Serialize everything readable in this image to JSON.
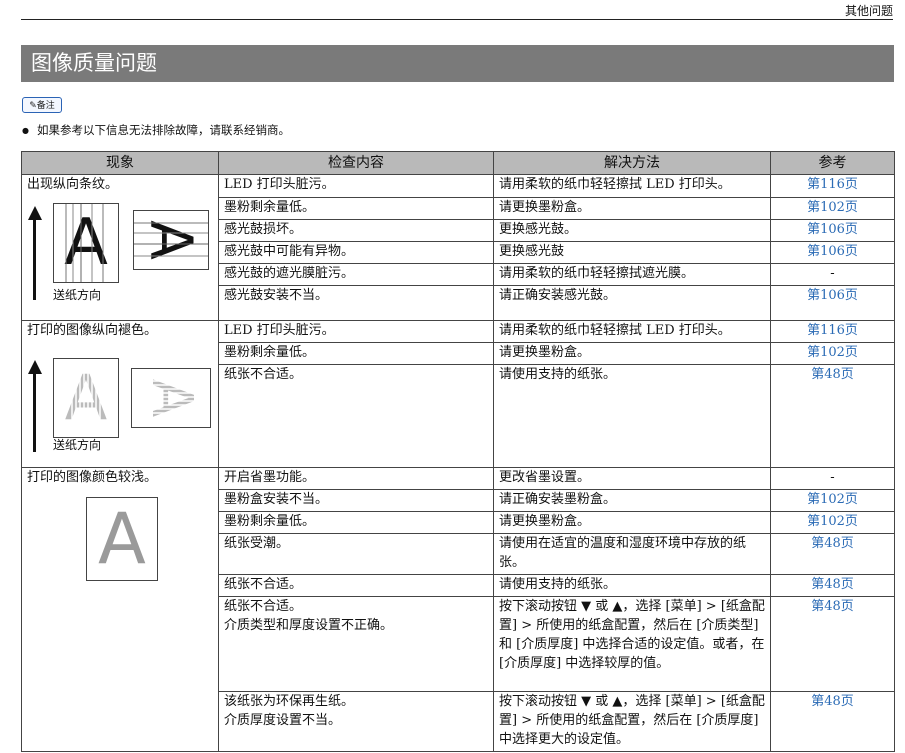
{
  "header": {
    "chapter": "其他问题"
  },
  "section": {
    "title": "图像质量问题"
  },
  "note": {
    "tag": "备注",
    "text": "如果参考以下信息无法排除故障，请联系经销商。"
  },
  "table": {
    "headers": [
      "现象",
      "检查内容",
      "解决方法",
      "参考"
    ],
    "groups": [
      {
        "symptom": "出现纵向条纹。",
        "direction_label": "送纸方向",
        "rows": [
          {
            "check": "LED 打印头脏污。",
            "solution": "请用柔软的纸巾轻轻擦拭 LED 打印头。",
            "ref": "第116页"
          },
          {
            "check": "墨粉剩余量低。",
            "solution": "请更换墨粉盒。",
            "ref": "第102页"
          },
          {
            "check": "感光鼓损坏。",
            "solution": "更换感光鼓。",
            "ref": "第106页"
          },
          {
            "check": "感光鼓中可能有异物。",
            "solution": "更换感光鼓",
            "ref": "第106页"
          },
          {
            "check": "感光鼓的遮光膜脏污。",
            "solution": "请用柔软的纸巾轻轻擦拭遮光膜。",
            "ref": "-"
          },
          {
            "check": "感光鼓安装不当。",
            "solution": "请正确安装感光鼓。",
            "ref": "第106页"
          }
        ]
      },
      {
        "symptom": "打印的图像纵向褪色。",
        "direction_label": "送纸方向",
        "rows": [
          {
            "check": "LED 打印头脏污。",
            "solution": "请用柔软的纸巾轻轻擦拭 LED 打印头。",
            "ref": "第116页"
          },
          {
            "check": "墨粉剩余量低。",
            "solution": "请更换墨粉盒。",
            "ref": "第102页"
          },
          {
            "check": "纸张不合适。",
            "solution": "请使用支持的纸张。",
            "ref": "第48页"
          }
        ]
      },
      {
        "symptom": "打印的图像颜色较浅。",
        "rows": [
          {
            "check": "开启省墨功能。",
            "solution": "更改省墨设置。",
            "ref": "-"
          },
          {
            "check": "墨粉盒安装不当。",
            "solution": "请正确安装墨粉盒。",
            "ref": "第102页"
          },
          {
            "check": "墨粉剩余量低。",
            "solution": "请更换墨粉盒。",
            "ref": "第102页"
          },
          {
            "check": "纸张受潮。",
            "solution": "请使用在适宜的温度和湿度环境中存放的纸张。",
            "ref": "第48页"
          },
          {
            "check": "纸张不合适。",
            "solution": "请使用支持的纸张。",
            "ref": "第48页"
          },
          {
            "check_lines": [
              "纸张不合适。",
              "介质类型和厚度设置不正确。"
            ],
            "solution": "按下滚动按钮 ▼ 或 ▲，选择 [菜单] > [纸盒配置] > 所使用的纸盒配置，然后在 [介质类型] 和 [介质厚度] 中选择合适的设定值。或者，在 [介质厚度] 中选择较厚的值。",
            "ref": "第48页"
          },
          {
            "check_lines": [
              "该纸张为环保再生纸。",
              "介质厚度设置不当。"
            ],
            "solution": "按下滚动按钮 ▼ 或 ▲，选择 [菜单] > [纸盒配置] > 所使用的纸盒配置，然后在 [介质厚度] 中选择更大的设定值。",
            "ref": "第48页"
          }
        ]
      }
    ],
    "sample_glyph": "A"
  }
}
